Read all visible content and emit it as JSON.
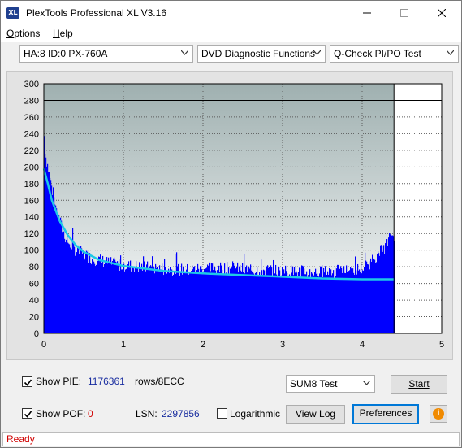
{
  "window": {
    "title": "PlexTools Professional XL V3.16",
    "icon_text": "XL",
    "icon": "app-logo-icon",
    "controls": [
      "minimize-icon",
      "maximize-icon",
      "close-icon"
    ]
  },
  "menu": {
    "options": {
      "label": "Options",
      "mnemonic": "O",
      "rest": "ptions"
    },
    "help": {
      "label": "Help",
      "mnemonic": "H",
      "rest": "elp"
    }
  },
  "toolbar": {
    "drive": "HA:8 ID:0  PX-760A",
    "function": "DVD Diagnostic Functions",
    "test": "Q-Check PI/PO Test"
  },
  "chart_data": {
    "type": "bar",
    "xlim": [
      0,
      5
    ],
    "ylim": [
      0,
      300
    ],
    "xticks": [
      0,
      1,
      2,
      3,
      4,
      5
    ],
    "yticks": [
      0,
      20,
      40,
      60,
      80,
      100,
      120,
      140,
      160,
      180,
      200,
      220,
      240,
      260,
      280,
      300
    ],
    "threshold_line": 280,
    "end_marker_x": 4.4,
    "series": [
      {
        "kind": "bars",
        "color": "#0000ff",
        "x": [
          0.0,
          0.02,
          0.05,
          0.1,
          0.15,
          0.2,
          0.25,
          0.3,
          0.4,
          0.5,
          0.6,
          0.7,
          0.8,
          0.9,
          1.0,
          1.2,
          1.4,
          1.6,
          1.8,
          2.0,
          2.2,
          2.4,
          2.6,
          2.8,
          3.0,
          3.2,
          3.4,
          3.6,
          3.8,
          4.0,
          4.1,
          4.2,
          4.3,
          4.35,
          4.4
        ],
        "y": [
          245,
          215,
          200,
          175,
          150,
          135,
          120,
          110,
          100,
          95,
          90,
          88,
          85,
          83,
          82,
          80,
          78,
          77,
          76,
          78,
          78,
          78,
          76,
          76,
          75,
          74,
          73,
          74,
          75,
          78,
          85,
          95,
          105,
          115,
          118
        ]
      },
      {
        "kind": "line",
        "color": "#1ec8e6",
        "x": [
          0.0,
          0.05,
          0.1,
          0.2,
          0.3,
          0.4,
          0.5,
          0.7,
          1.0,
          1.5,
          2.0,
          2.5,
          3.0,
          3.5,
          4.0,
          4.4
        ],
        "y": [
          198,
          180,
          160,
          135,
          118,
          106,
          98,
          88,
          81,
          75,
          72,
          70,
          68,
          66,
          65,
          65
        ]
      }
    ]
  },
  "controls": {
    "show_pie_label": "Show PIE:",
    "pie_count": "1176361",
    "pie_unit": "rows/8ECC",
    "show_pof_label": "Show POF:",
    "pof_count": "0",
    "lsn_label": "LSN:",
    "lsn_value": "2297856",
    "logarithmic_label": "Logarithmic",
    "sum_test": "SUM8 Test",
    "start": "Start",
    "view_log": "View Log",
    "preferences": "Preferences",
    "info_icon_text": "i",
    "show_pie_checked": true,
    "show_pof_checked": true,
    "logarithmic_checked": false
  },
  "status": {
    "text": "Ready"
  }
}
